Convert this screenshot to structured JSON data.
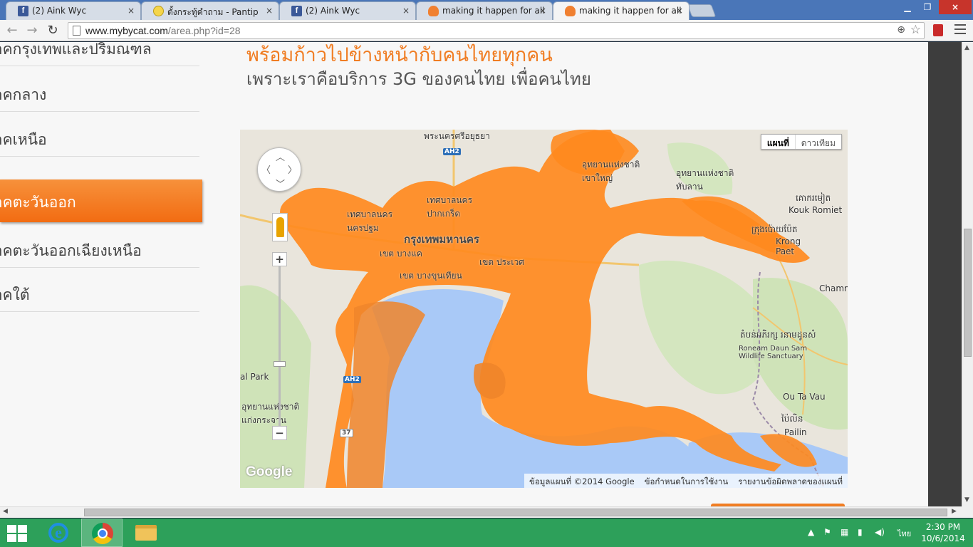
{
  "browser": {
    "tabs": [
      {
        "title": "(2) Aink Wyc",
        "favicon": "facebook-icon"
      },
      {
        "title": "ตั้งกระทู้คำถาม - Pantip",
        "favicon": "pantip-icon"
      },
      {
        "title": "(2) Aink Wyc",
        "favicon": "facebook-icon"
      },
      {
        "title": "making it happen for all",
        "favicon": "mybycat-icon"
      },
      {
        "title": "making it happen for all",
        "favicon": "mybycat-icon",
        "active": true
      }
    ],
    "fb_letter": "f",
    "close_symbol": "×",
    "url_host": "www.mybycat.com",
    "url_path": "/area.php?id=28"
  },
  "sidebar": {
    "items": [
      {
        "label": "ภาคกรุงเทพและปริมณฑล"
      },
      {
        "label": "ภาคกลาง"
      },
      {
        "label": "ภาคเหนือ"
      },
      {
        "label": "ภาคตะวันออก",
        "active": true
      },
      {
        "label": "ภาคตะวันออกเฉียงเหนือ"
      },
      {
        "label": "ภาคใต้"
      }
    ]
  },
  "headline": {
    "line1": "พร้อมก้าวไปข้างหน้ากับคนไทยทุกคน",
    "line2": "เพราะเราคือบริการ 3G ของคนไทย เพื่อคนไทย"
  },
  "map": {
    "type_map": "แผนที่",
    "type_satellite": "ดาวเทียม",
    "logo": "Google",
    "footer": {
      "copyright": "ข้อมูลแผนที่ ©2014 Google",
      "terms": "ข้อกำหนดในการใช้งาน",
      "report": "รายงานข้อผิดพลาดของแผนที่"
    },
    "zoom_in": "+",
    "zoom_out": "−",
    "labels": {
      "bangkok": "กรุงเทพมหานคร",
      "ayutthaya": "พระนครศรีอยุธยา",
      "pathum": "เทศบาลนคร ปากเกร็ด",
      "nakhon_pathom": "เทศบาลนคร นครปฐม",
      "bang_khae": "เขต บางแค",
      "prawet": "เขต ประเวศ",
      "bang_khun_thian": "เขต บางขุนเทียน",
      "kouk_romiet": "Kouk Romiet",
      "kouk_romiet_kh": "គោករមៀត",
      "krong_paet": "Krong Paet",
      "krong_paet_kh": "ក្រុងប៉ោយប៉ែត",
      "chamm": "Chamm",
      "roneam": "Roneam Daun Sam Wildlife Sanctuary",
      "roneam_kh": "តំបន់អភិរក្ស រនាមដូនសំ",
      "ou_ta_vau": "Ou Ta Vau",
      "pailin": "Pailin",
      "pailin_kh": "ប៉ៃលិន",
      "park": "al Park",
      "kaeng_krachan": "อุทยานแห่งชาติ แก่งกระจาน",
      "thap_lan": "อุทยานแห่งชาติ ทับลาน",
      "khao_yai": "อุทยานแห่งชาติ เขาใหญ่",
      "ah2": "AH2",
      "ah2b": "AH2",
      "r37": "37"
    }
  },
  "taskbar": {
    "clock_time": "2:30 PM",
    "clock_date": "10/6/2014",
    "language": "ไทย"
  }
}
